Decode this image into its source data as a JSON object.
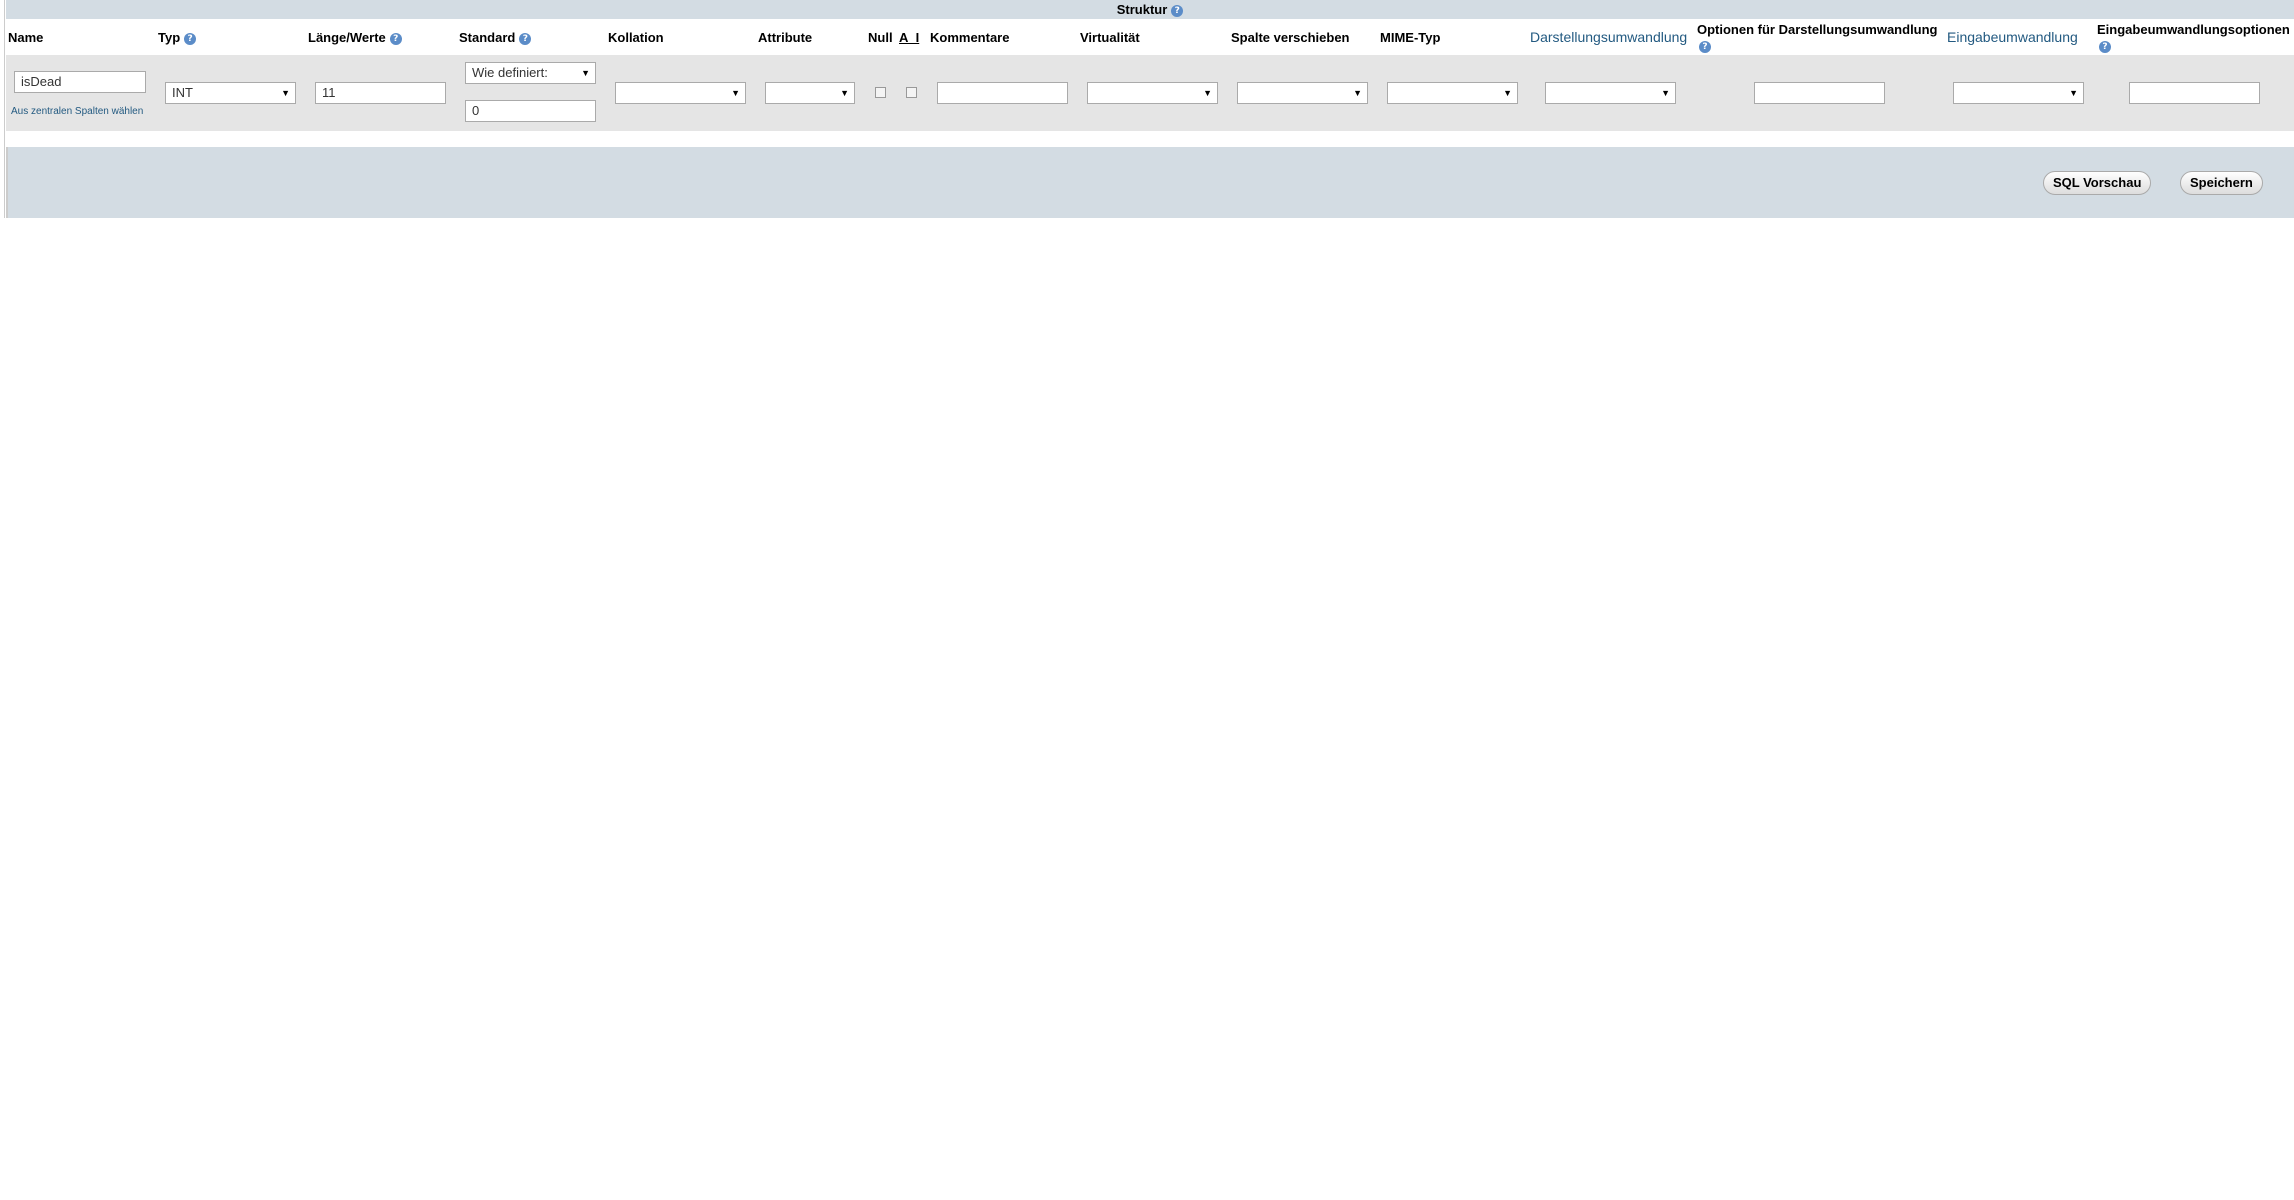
{
  "structure_title": "Struktur",
  "headers": {
    "name": "Name",
    "typ": "Typ",
    "laenge": "Länge/Werte",
    "standard": "Standard",
    "kollation": "Kollation",
    "attribute": "Attribute",
    "null": "Null",
    "ai": "A_I",
    "kommentare": "Kommentare",
    "virtualitaet": "Virtualität",
    "spalte_verschieben": "Spalte verschieben",
    "mime_typ": "MIME-Typ",
    "darstellungsumwandlung": "Darstellungsumwandlung",
    "optionen_darstellung": "Optionen für Darstellungsumwandlung",
    "eingabeumwandlung": "Eingabeumwandlung",
    "eingabeumwandlungsoptionen": "Eingabeumwandlungsoptionen"
  },
  "row": {
    "name_value": "isDead",
    "central_columns_link": "Aus zentralen Spalten wählen",
    "typ_selected": "INT",
    "laenge_value": "11",
    "standard_selected": "Wie definiert:",
    "standard_value": "0",
    "kollation_selected": "",
    "attribute_selected": "",
    "kommentare_value": "",
    "virtualitaet_selected": "",
    "spalte_verschieben_selected": "",
    "mime_typ_selected": "",
    "darstellungsumwandlung_selected": "",
    "optionen_darstellung_value": "",
    "eingabeumwandlung_selected": "",
    "eingabeumwandlungsoptionen_value": ""
  },
  "buttons": {
    "sql_preview": "SQL Vorschau",
    "save": "Speichern"
  },
  "icons": {
    "help": "help-icon",
    "dropdown": "chevron-down-icon"
  },
  "colors": {
    "bar": "#d3dce3",
    "row": "#e5e5e5",
    "link": "#235a81"
  }
}
